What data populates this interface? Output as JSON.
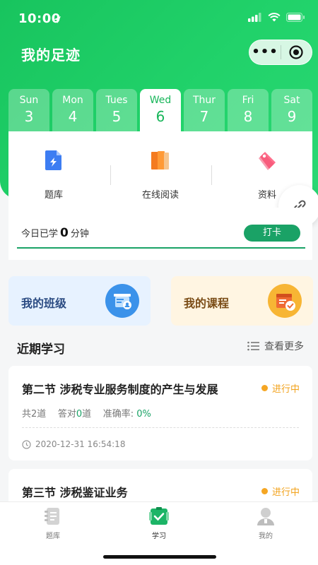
{
  "status_bar": {
    "time": "10:00"
  },
  "header": {
    "title": "我的足迹",
    "more_glyph": "•••"
  },
  "days": [
    {
      "name": "Sun",
      "num": "3"
    },
    {
      "name": "Mon",
      "num": "4"
    },
    {
      "name": "Tues",
      "num": "5"
    },
    {
      "name": "Wed",
      "num": "6",
      "active": true
    },
    {
      "name": "Thur",
      "num": "7"
    },
    {
      "name": "Fri",
      "num": "8"
    },
    {
      "name": "Sat",
      "num": "9"
    }
  ],
  "tools": [
    {
      "label": "题库",
      "icon": "question-bank-icon"
    },
    {
      "label": "在线阅读",
      "icon": "book-icon"
    },
    {
      "label": "资料",
      "icon": "tag-icon"
    }
  ],
  "checkin": {
    "prefix": "今日已学",
    "minutes": "0",
    "suffix": "分钟",
    "button": "打卡"
  },
  "quick": [
    {
      "label": "我的班级",
      "icon": "class-board-icon"
    },
    {
      "label": "我的课程",
      "icon": "course-calendar-icon"
    }
  ],
  "recent": {
    "title": "近期学习",
    "more": "查看更多"
  },
  "lessons": [
    {
      "title": "第二节 涉税专业服务制度的产生与发展",
      "status": "进行中",
      "total_label": "共",
      "total": "2",
      "total_unit": "道",
      "correct_label": "答对",
      "correct": "0",
      "correct_unit": "道",
      "rate_label": "准确率:",
      "rate": "0%",
      "time": "2020-12-31 16:54:18"
    },
    {
      "title": "第三节 涉税鉴证业务",
      "status": "进行中"
    }
  ],
  "tabbar": [
    {
      "label": "题库",
      "icon": "question-bank-icon"
    },
    {
      "label": "学习",
      "icon": "study-icon",
      "active": true
    },
    {
      "label": "我的",
      "icon": "profile-icon"
    }
  ],
  "colors": {
    "primary": "#1cc962",
    "accent_green": "#1aa266",
    "status_orange": "#f5a623"
  }
}
